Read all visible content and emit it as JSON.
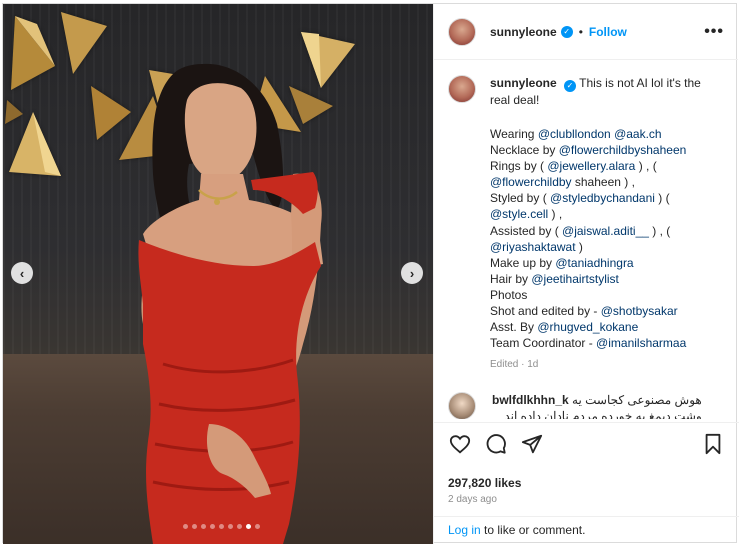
{
  "post": {
    "username": "sunnyleone",
    "follow_label": "Follow",
    "separator": "•",
    "more_label": "•••",
    "caption_first": "This is not AI lol it's the real deal!",
    "caption_lines": [
      [
        "Wearing ",
        "@clubllondon",
        " ",
        "@aak.ch"
      ],
      [
        "Necklace by ",
        "@flowerchildbyshaheen"
      ],
      [
        "Rings by ( ",
        "@jewellery.alara",
        " ) , ("
      ],
      [
        "",
        "@flowerchildby",
        " shaheen ) ,"
      ],
      [
        "Styled by ( ",
        "@styledbychandani",
        " ) ("
      ],
      [
        "",
        "@style.cell",
        " ) ,"
      ],
      [
        "Assisted by ( ",
        "@jaiswal.aditi__",
        " ) , ("
      ],
      [
        "",
        "@riyashaktawat",
        " )"
      ],
      [
        "Make up by ",
        "@taniadhingra"
      ],
      [
        "Hair by ",
        "@jeetihairtstylist"
      ],
      [
        "Photos",
        ""
      ],
      [
        "Shot and edited by - ",
        "@shotbysakar"
      ],
      [
        "Asst. By ",
        "@rhugved_kokane"
      ],
      [
        "Team Coordinator - ",
        "@imanilsharmaa"
      ]
    ],
    "edited": "Edited · 1d",
    "comment": {
      "username": "bwlfdlkhhn_k",
      "text": "هوش مصنوعی کجاست یه",
      "text2": "وشت دیمغ به خورده مردم نادان داده اند"
    },
    "likes": "297,820 likes",
    "time_ago": "2 days ago",
    "login_link": "Log in",
    "login_rest": " to like or comment."
  },
  "carousel": {
    "count": 9,
    "active_index": 7,
    "prev": "‹",
    "next": "›"
  },
  "colors": {
    "accent": "#0095f6",
    "dress": "#c8281e",
    "gold": "#c9a24a"
  }
}
